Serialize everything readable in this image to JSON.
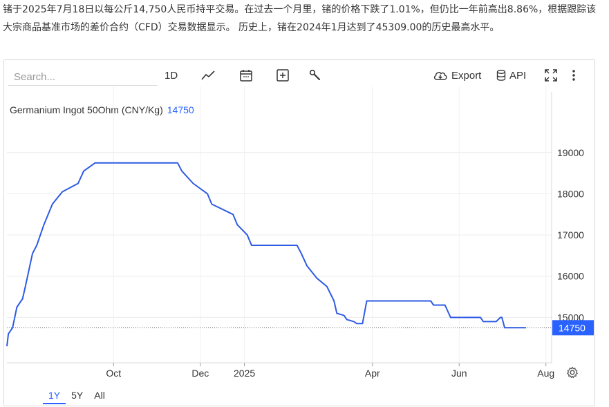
{
  "intro_text": "锗于2025年7月18日以每公斤14,750人民币持平交易。在过去一个月里，锗的价格下跌了1.01%，但仍比一年前高出8.86%，根据跟踪该大宗商品基准市场的差价合约（CFD）交易数据显示。 历史上，锗在2024年1月达到了45309.00的历史最高水平。",
  "toolbar": {
    "search_placeholder": "Search...",
    "interval_label": "1D",
    "export_label": "Export",
    "api_label": "API"
  },
  "chart_header": {
    "name": "Germanium Ingot 50Ohm (CNY/Kg)",
    "value": "14750"
  },
  "ranges": [
    {
      "label": "1Y",
      "active": true
    },
    {
      "label": "5Y",
      "active": false
    },
    {
      "label": "All",
      "active": false
    }
  ],
  "colors": {
    "line": "#2d5be3",
    "accent": "#2962ff",
    "last_badge": "#2962ff"
  },
  "chart_data": {
    "type": "line",
    "title": "Germanium Ingot 50Ohm (CNY/Kg)",
    "xlabel": "",
    "ylabel": "",
    "ylim": [
      13900,
      19600
    ],
    "yticks": [
      15000,
      16000,
      17000,
      18000,
      19000
    ],
    "xticks": [
      "Oct",
      "Dec",
      "2025",
      "Apr",
      "Jun",
      "Aug"
    ],
    "last_value": 14750,
    "grid": true,
    "series": [
      {
        "name": "Germanium Ingot 50Ohm (CNY/Kg)",
        "points": [
          [
            "2024-07-18",
            14300
          ],
          [
            "2024-07-19",
            14600
          ],
          [
            "2024-07-22",
            14750
          ],
          [
            "2024-07-25",
            15250
          ],
          [
            "2024-07-29",
            15450
          ],
          [
            "2024-07-31",
            15750
          ],
          [
            "2024-08-05",
            16550
          ],
          [
            "2024-08-08",
            16750
          ],
          [
            "2024-08-13",
            17250
          ],
          [
            "2024-08-19",
            17750
          ],
          [
            "2024-08-26",
            18050
          ],
          [
            "2024-09-06",
            18250
          ],
          [
            "2024-09-10",
            18550
          ],
          [
            "2024-09-18",
            18750
          ],
          [
            "2024-11-15",
            18750
          ],
          [
            "2024-11-18",
            18550
          ],
          [
            "2024-11-26",
            18250
          ],
          [
            "2024-12-06",
            18000
          ],
          [
            "2024-12-09",
            17750
          ],
          [
            "2024-12-24",
            17500
          ],
          [
            "2024-12-27",
            17250
          ],
          [
            "2025-01-03",
            17000
          ],
          [
            "2025-01-06",
            16750
          ],
          [
            "2025-01-13",
            16750
          ],
          [
            "2025-02-07",
            16750
          ],
          [
            "2025-02-10",
            16550
          ],
          [
            "2025-02-14",
            16250
          ],
          [
            "2025-02-21",
            15950
          ],
          [
            "2025-02-28",
            15750
          ],
          [
            "2025-03-05",
            15400
          ],
          [
            "2025-03-07",
            15100
          ],
          [
            "2025-03-12",
            15050
          ],
          [
            "2025-03-14",
            14950
          ],
          [
            "2025-03-19",
            14900
          ],
          [
            "2025-03-21",
            14850
          ],
          [
            "2025-03-25",
            14850
          ],
          [
            "2025-03-28",
            15400
          ],
          [
            "2025-05-12",
            15400
          ],
          [
            "2025-05-14",
            15300
          ],
          [
            "2025-05-22",
            15300
          ],
          [
            "2025-05-26",
            15000
          ],
          [
            "2025-06-16",
            15000
          ],
          [
            "2025-06-18",
            14900
          ],
          [
            "2025-06-27",
            14900
          ],
          [
            "2025-06-30",
            15000
          ],
          [
            "2025-07-01",
            15000
          ],
          [
            "2025-07-03",
            14750
          ],
          [
            "2025-07-18",
            14750
          ]
        ]
      }
    ]
  }
}
